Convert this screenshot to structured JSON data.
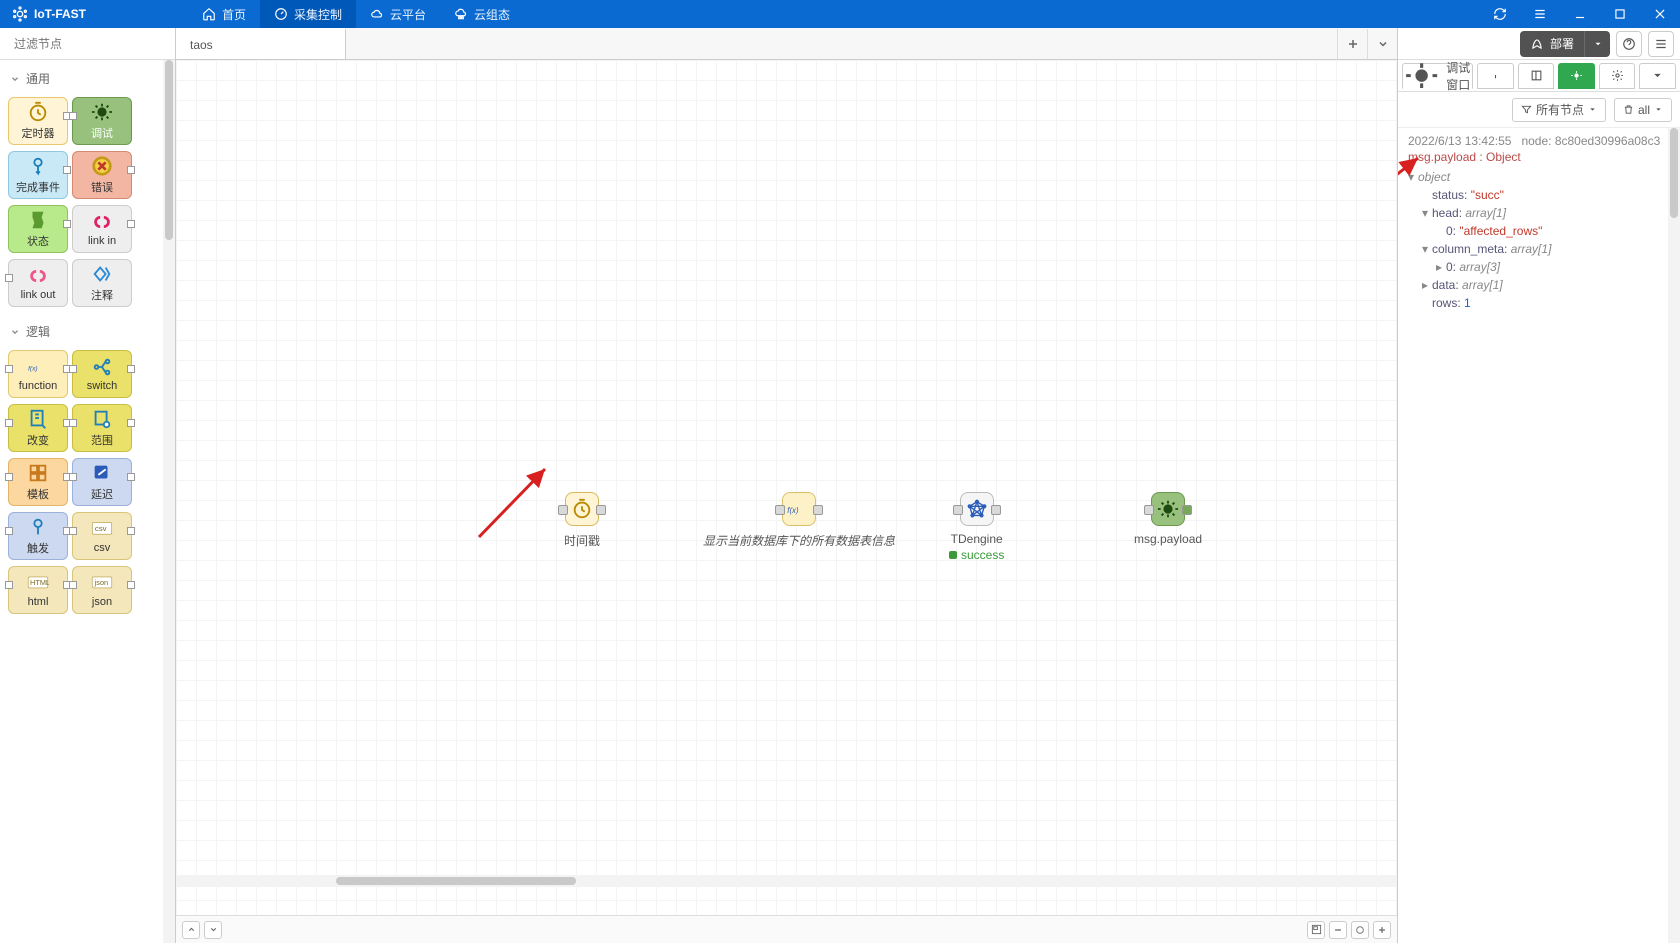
{
  "app_title": "IoT-FAST",
  "nav": {
    "home": "首页",
    "collect": "采集控制",
    "cloud": "云平台",
    "cloudcfg": "云组态"
  },
  "palette": {
    "search_placeholder": "过滤节点",
    "cats": {
      "general": "通用",
      "logic": "逻辑"
    },
    "general": {
      "timer": "定时器",
      "debug": "调试",
      "complete": "完成事件",
      "error": "错误",
      "status": "状态",
      "link_in": "link in",
      "link_out": "link out",
      "comment": "注释"
    },
    "logic": {
      "function": "function",
      "switch": "switch",
      "change": "改变",
      "range": "范围",
      "template": "模板",
      "delay": "延迟",
      "trigger": "触发",
      "csv": "csv",
      "html": "html",
      "json": "json"
    }
  },
  "tabs": {
    "tab1": "taos"
  },
  "flow": {
    "n1": {
      "label": "时间戳"
    },
    "n2": {
      "label": "显示当前数据库下的所有数据表信息"
    },
    "n3": {
      "label": "TDengine",
      "status": "success"
    },
    "n4": {
      "label": "msg.payload"
    }
  },
  "rightpane": {
    "deploy": "部署",
    "debug_tab": "调试窗口",
    "filter_all_nodes": "所有节点",
    "filter_trash": "all"
  },
  "debug": {
    "timestamp": "2022/6/13 13:42:55",
    "node_label": "node:",
    "node_id": "8c80ed30996a08c3",
    "title": "msg.payload : Object",
    "object_text": "object",
    "status_key": "status:",
    "status_val": "\"succ\"",
    "head_key": "head:",
    "head_type": "array[1]",
    "head_0_key": "0:",
    "head_0_val": "\"affected_rows\"",
    "colmeta_key": "column_meta:",
    "colmeta_type": "array[1]",
    "colmeta_0_key": "0:",
    "colmeta_0_type": "array[3]",
    "data_key": "data:",
    "data_type": "array[1]",
    "rows_key": "rows:",
    "rows_val": "1"
  }
}
